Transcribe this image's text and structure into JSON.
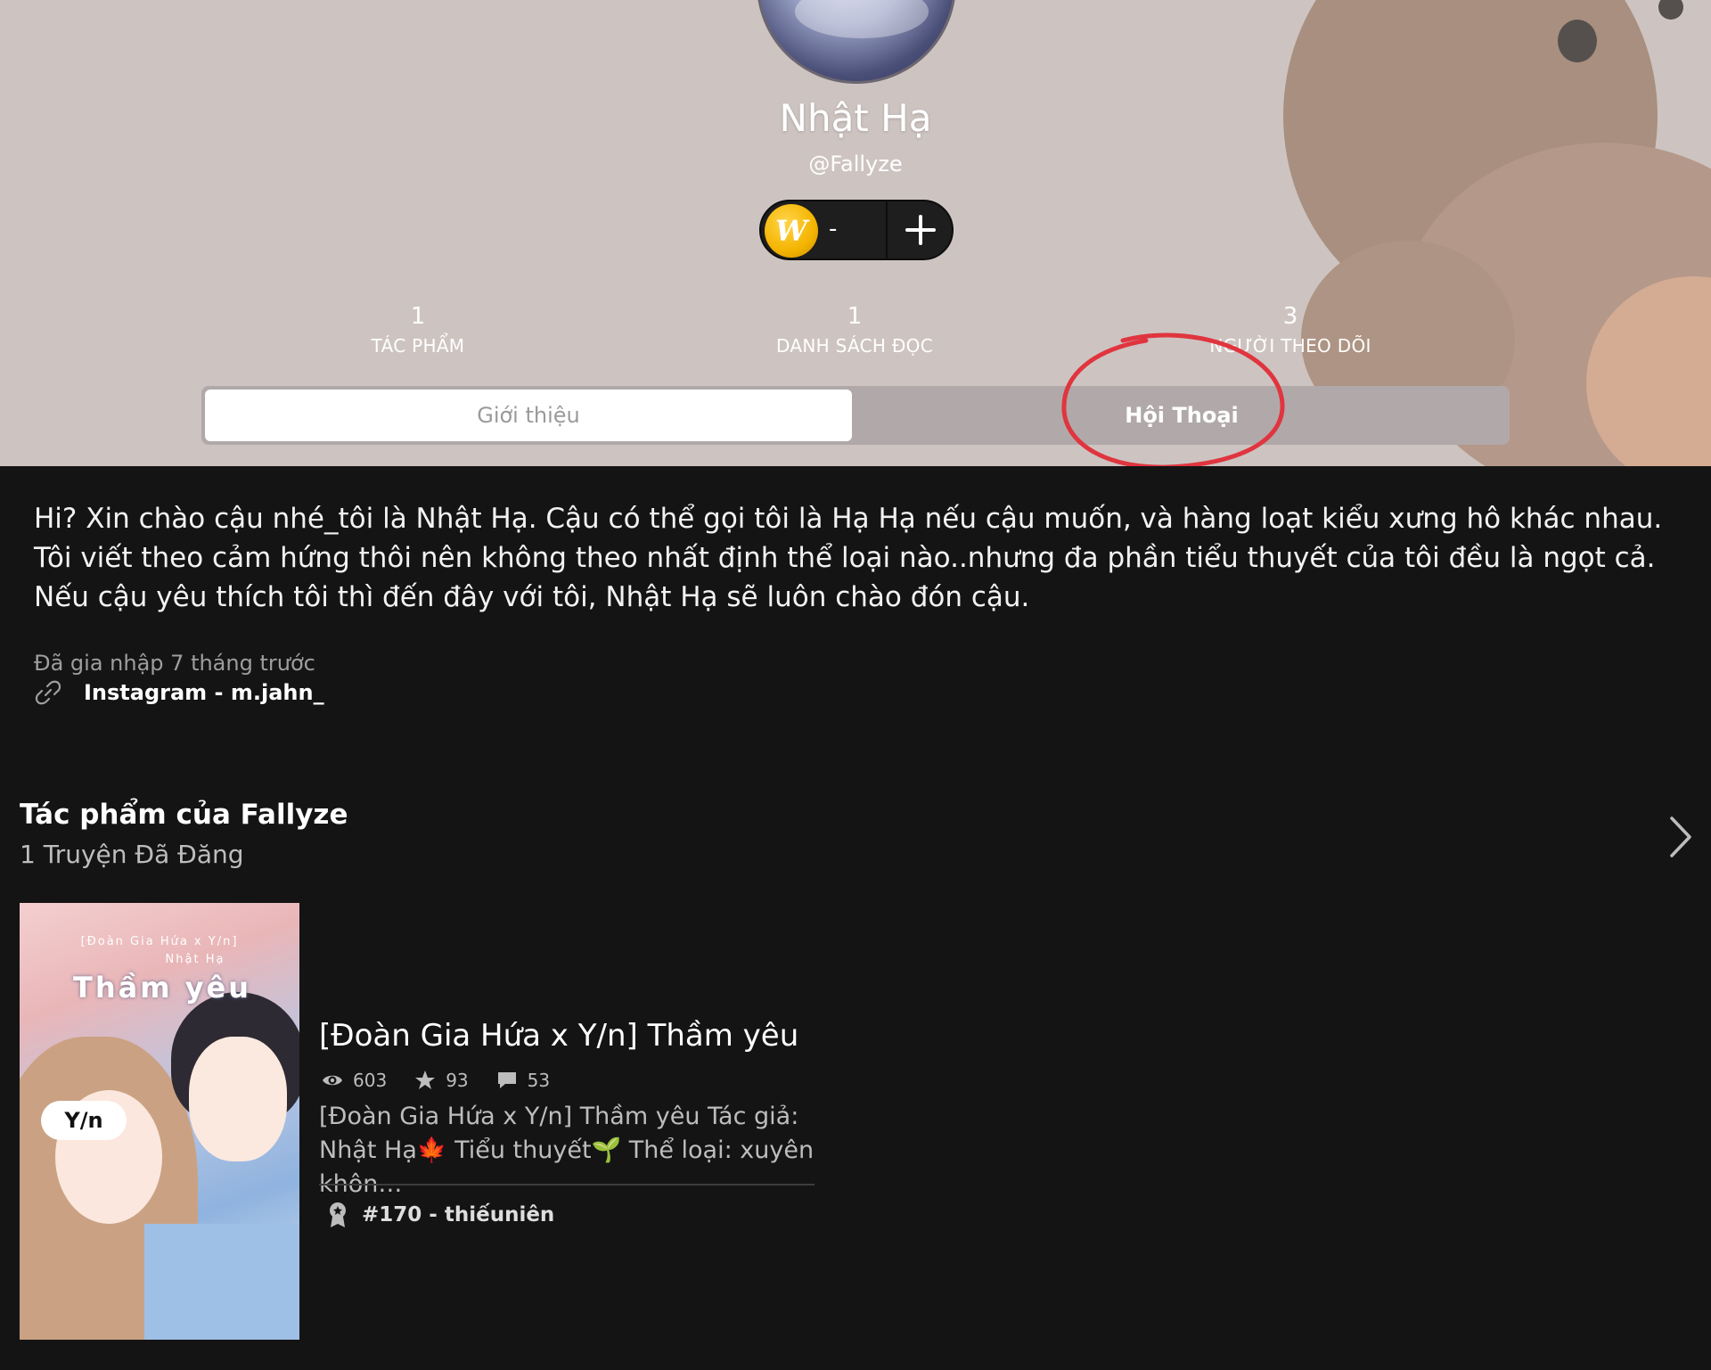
{
  "profile": {
    "display_name": "Nhật Hạ",
    "username": "@Fallyze",
    "coin_symbol": "W",
    "coin_count": "-"
  },
  "stats": [
    {
      "value": "1",
      "label": "TÁC PHẨM"
    },
    {
      "value": "1",
      "label": "DANH SÁCH ĐỌC"
    },
    {
      "value": "3",
      "label": "NGƯỜI THEO DÕI"
    }
  ],
  "tabs": {
    "about": "Giới thiệu",
    "conversations": "Hội Thoại"
  },
  "about": {
    "text": "Hi? Xin chào cậu nhé_tôi là Nhật Hạ. Cậu có thể gọi tôi là Hạ Hạ nếu cậu muốn, và hàng loạt kiểu xưng hô khác nhau. Tôi viết theo cảm hứng thôi nên không theo nhất định thể loại nào..nhưng đa phần tiểu thuyết của tôi đều là ngọt cả. Nếu cậu yêu thích tôi thì đến đây với tôi, Nhật Hạ sẽ luôn chào đón cậu.",
    "joined": "Đã gia nhập 7 tháng trước",
    "link": "Instagram - m.jahn_"
  },
  "works": {
    "title": "Tác phẩm của Fallyze",
    "subtitle": "1 Truyện Đã Đăng"
  },
  "story": {
    "title": "[Đoàn Gia Hứa x Y/n] Thầm yêu",
    "reads": "603",
    "votes": "93",
    "comments": "53",
    "description": "[Đoàn Gia Hứa x Y/n] Thầm yêu Tác giả: Nhật Hạ🍁 Tiểu thuyết🌱 Thể loại: xuyên khôn…",
    "rank": "#170 - thiếuniên",
    "cover": {
      "series": "[Đoàn Gia Hứa x Y/n]",
      "author": "Nhật Hạ",
      "title": "Thầm yêu",
      "yn_label": "Y/n"
    }
  },
  "colors": {
    "header_bg": "#cdc4c1",
    "body_bg": "#141414",
    "annotation_red": "#e0353f",
    "coin_gold": "#f4b400"
  }
}
